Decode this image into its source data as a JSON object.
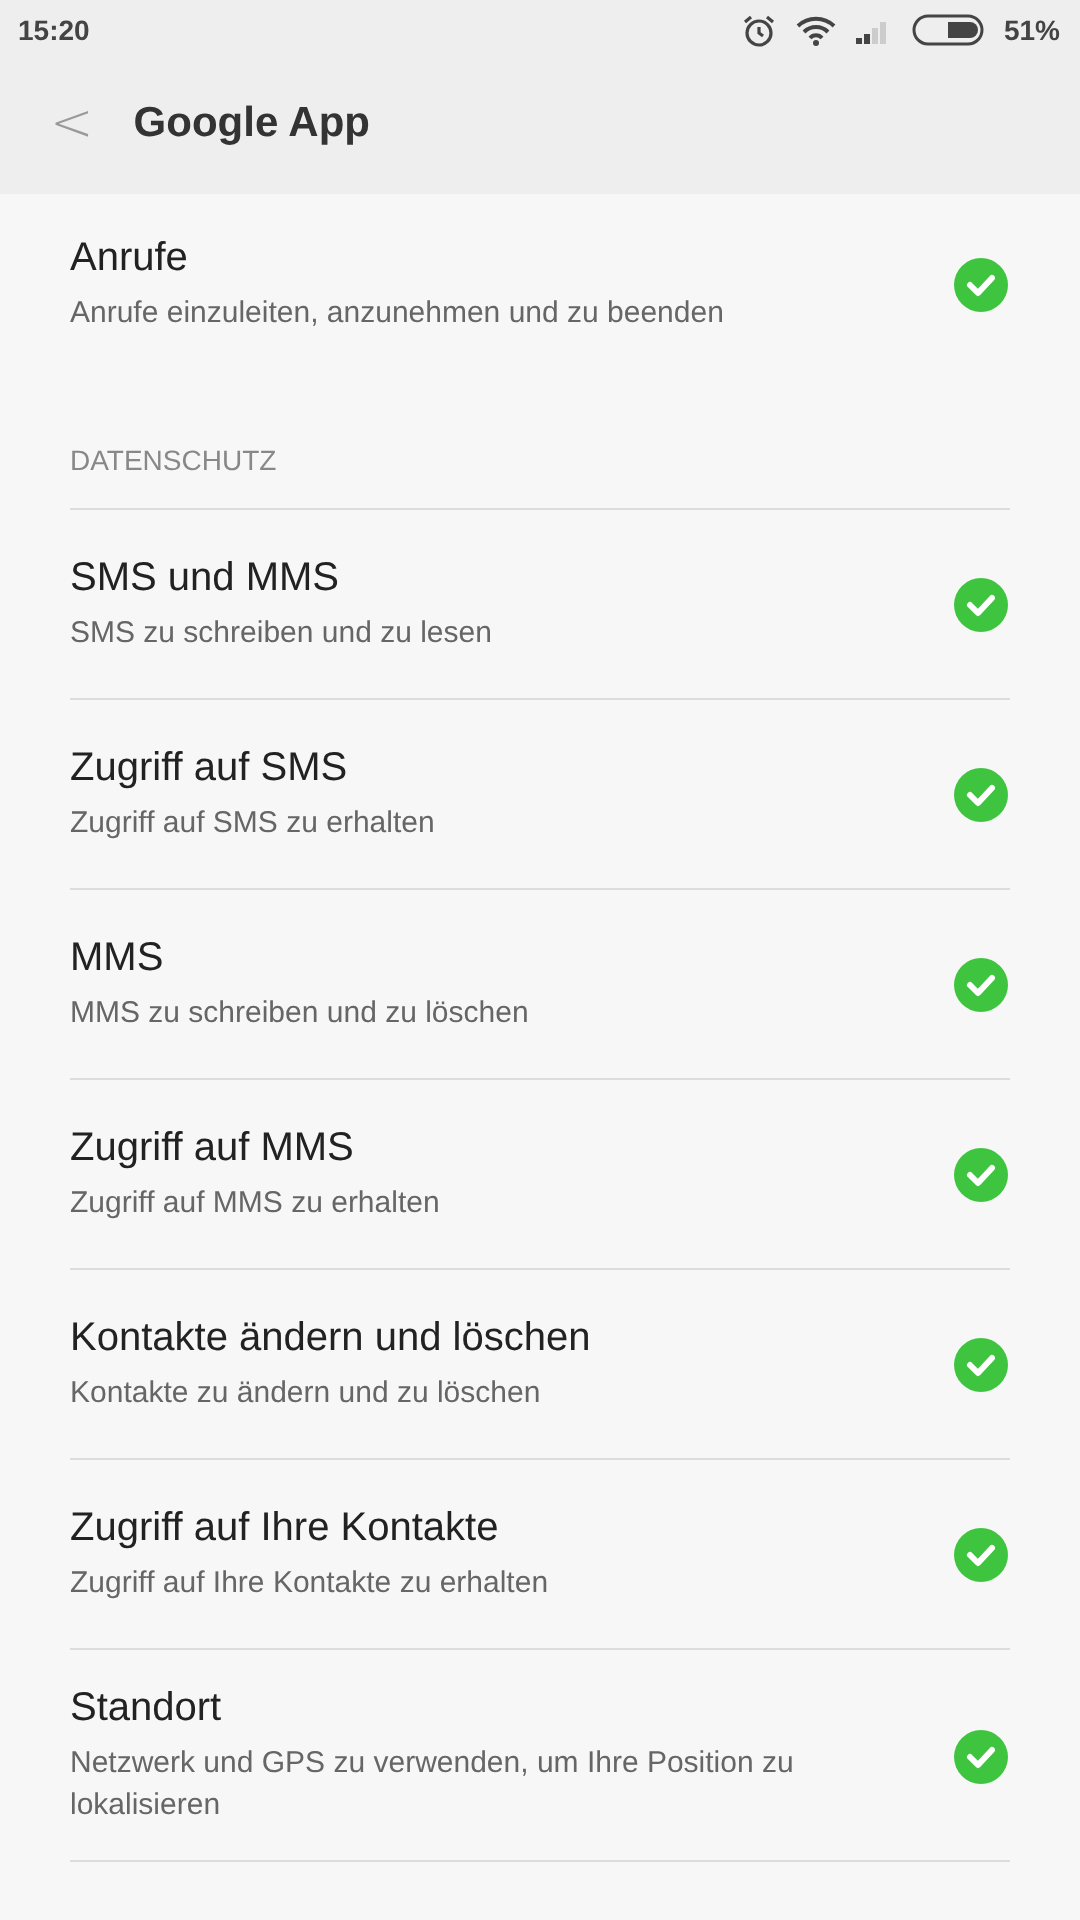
{
  "status_bar": {
    "time": "15:20",
    "battery": "51%"
  },
  "header": {
    "back": "<",
    "title": "Google App"
  },
  "sections": [
    {
      "items": [
        {
          "title": "Anrufe",
          "subtitle": "Anrufe einzuleiten, anzunehmen und zu beenden",
          "allowed": true
        }
      ]
    },
    {
      "header": "DATENSCHUTZ",
      "items": [
        {
          "title": "SMS und MMS",
          "subtitle": "SMS zu schreiben und zu lesen",
          "allowed": true
        },
        {
          "title": "Zugriff auf SMS",
          "subtitle": "Zugriff auf SMS zu erhalten",
          "allowed": true
        },
        {
          "title": "MMS",
          "subtitle": "MMS zu schreiben und zu löschen",
          "allowed": true
        },
        {
          "title": "Zugriff auf MMS",
          "subtitle": "Zugriff auf MMS zu erhalten",
          "allowed": true
        },
        {
          "title": "Kontakte ändern und löschen",
          "subtitle": "Kontakte zu ändern und zu löschen",
          "allowed": true
        },
        {
          "title": "Zugriff auf Ihre Kontakte",
          "subtitle": "Zugriff auf Ihre Kontakte zu erhalten",
          "allowed": true
        },
        {
          "title": "Standort",
          "subtitle": "Netzwerk und GPS zu verwenden, um Ihre Position zu lokalisieren",
          "allowed": true
        }
      ]
    }
  ]
}
